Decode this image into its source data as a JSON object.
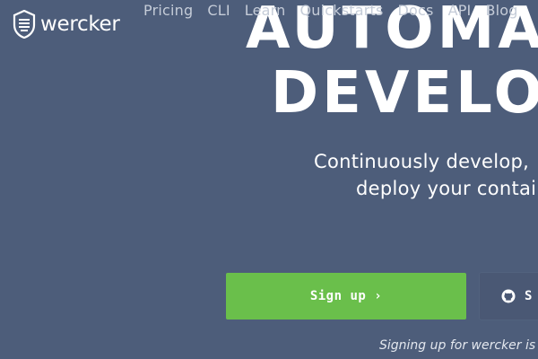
{
  "brand": {
    "name": "wercker",
    "logo_icon": "wercker-shield-icon"
  },
  "nav": {
    "items": [
      {
        "label": "Pricing"
      },
      {
        "label": "CLI"
      },
      {
        "label": "Learn"
      },
      {
        "label": "Quickstarts"
      },
      {
        "label": "Docs"
      },
      {
        "label": "API"
      },
      {
        "label": "Blog"
      }
    ]
  },
  "hero": {
    "headline_line1": "AUTOMATE",
    "headline_line2": "DEVELOPM",
    "sub_line1": "Continuously develop,",
    "sub_line2": "deploy your contai",
    "signup_label": "Sign up ›",
    "github_label": "S",
    "github_icon": "github-icon",
    "footnote": "Signing up for wercker is f"
  },
  "colors": {
    "background": "#4d5d7a",
    "signup_button": "#6abf4b",
    "github_button": "#4a5874",
    "nav_text": "#c5ccd8"
  }
}
